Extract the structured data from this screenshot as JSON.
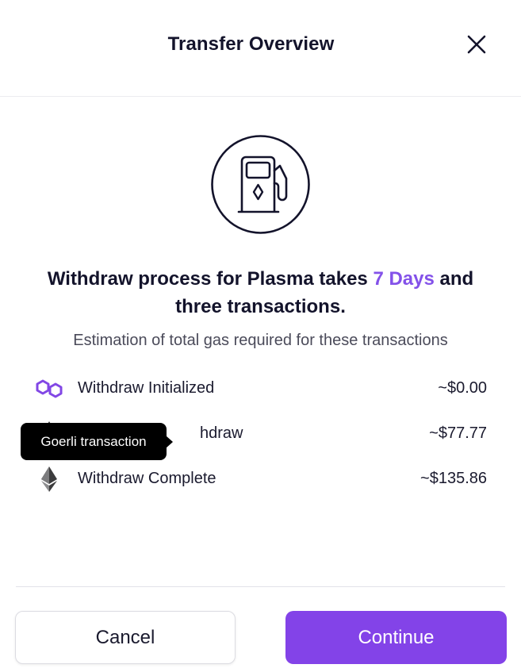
{
  "header": {
    "title": "Transfer Overview",
    "close_icon": "close-icon"
  },
  "hero": {
    "icon": "gas-pump-icon",
    "headline_prefix": "Withdraw process for Plasma takes ",
    "headline_accent": "7 Days",
    "headline_suffix": " and three transactions.",
    "accent_color": "#8351e9",
    "subtitle": "Estimation of total gas required for these transactions"
  },
  "transactions": [
    {
      "icon": "polygon-icon",
      "label": "Withdraw Initialized",
      "amount": "~$0.00"
    },
    {
      "icon": "ethereum-icon",
      "label": "Withdraw Challenge Withdraw",
      "visible_label": "hdraw",
      "amount": "~$77.77"
    },
    {
      "icon": "ethereum-icon",
      "label": "Withdraw Complete",
      "amount": "~$135.86"
    }
  ],
  "tooltip": {
    "text": "Goerli transaction"
  },
  "footer": {
    "cancel_label": "Cancel",
    "continue_label": "Continue",
    "continue_color": "#8343e8"
  }
}
